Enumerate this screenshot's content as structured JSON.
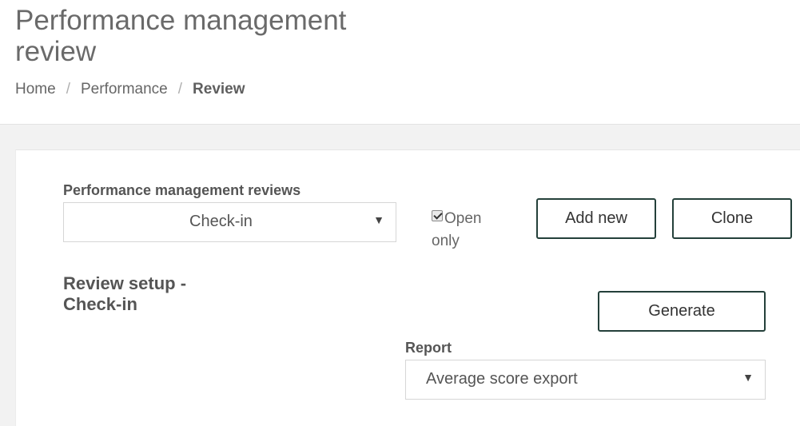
{
  "header": {
    "title": "Performance management review",
    "breadcrumb": [
      {
        "label": "Home"
      },
      {
        "label": "Performance"
      },
      {
        "label": "Review"
      }
    ]
  },
  "reviews": {
    "label": "Performance management reviews",
    "selected": "Check-in",
    "open_only_label": "Open only",
    "open_only_checked": true,
    "add_new_label": "Add new",
    "clone_label": "Clone"
  },
  "setup": {
    "title": "Review setup - Check-in",
    "generate_label": "Generate",
    "report_label": "Report",
    "report_selected": "Average score export"
  },
  "icons": {
    "dropdown": "caret-down-icon",
    "checkbox": "checkbox-checked-icon"
  },
  "colors": {
    "button_border": "#24403a",
    "band_background": "#f2f2f2"
  }
}
